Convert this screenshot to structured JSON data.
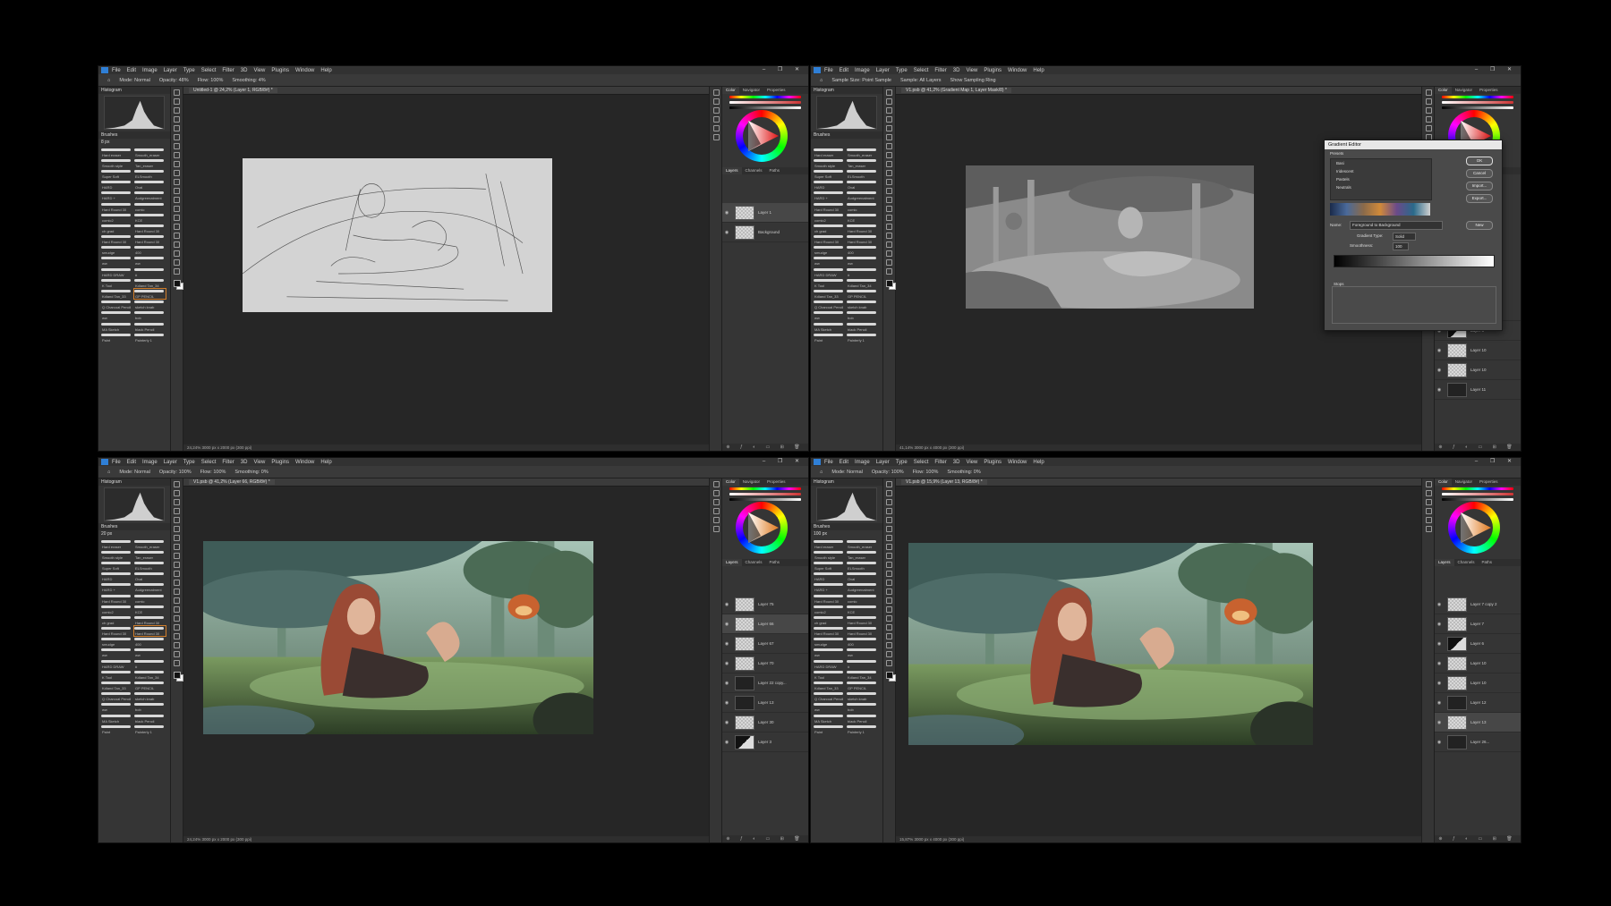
{
  "menu": [
    "File",
    "Edit",
    "Image",
    "Layer",
    "Type",
    "Select",
    "Filter",
    "3D",
    "View",
    "Plugins",
    "Window",
    "Help"
  ],
  "window_controls": "– ❐ ✕",
  "panel_titles": {
    "histogram": "Histogram",
    "brushes": "Brushes"
  },
  "right_tabs": [
    "Color",
    "Navigator",
    "Properties"
  ],
  "layer_tabs": [
    "Layers",
    "Channels",
    "Paths"
  ],
  "brushes": [
    [
      "Hard eraser",
      "Smooth_eraser"
    ],
    [
      "Smooth style",
      "Tan_eraser"
    ],
    [
      "Super Soft",
      "ELSmooth"
    ],
    [
      "HARD",
      "Oval"
    ],
    [
      "HARD +",
      "Audgreenatment"
    ],
    [
      "Hard Round 30",
      "comic"
    ],
    [
      "comic2",
      "KCE"
    ],
    [
      "ch grad",
      "Hard Round 30"
    ],
    [
      "Hard Round 30",
      "Hard Round 30"
    ],
    [
      "smudge",
      "400"
    ],
    [
      "ww",
      "ww"
    ],
    [
      "HARD DRAW",
      "#"
    ],
    [
      "K Tool",
      "Kdland Tan_34"
    ],
    [
      "Kdland Tan_33",
      "GP PENCIL"
    ],
    [
      "Q Charcoal Pencil",
      "sketch knab"
    ],
    [
      "ww",
      "bob"
    ],
    [
      "MA Sketch",
      "black Pencil"
    ],
    [
      "Paint",
      "Painterly 1"
    ]
  ],
  "panels": [
    {
      "tab": "Untitled-1 @ 24,2% (Layer 1, RGB/8#) *",
      "status": "24,24%   3000 px x 2000 px (300 ppi)",
      "options": [
        "Mode: Normal",
        "Opacity: 48%",
        "Flow: 100%",
        "Smoothing: 4%"
      ],
      "brush_size": "8 px",
      "layers": [
        {
          "name": "Layer 1",
          "thumb": "light",
          "selected": true
        },
        {
          "name": "Background",
          "thumb": "light",
          "selected": false
        }
      ]
    },
    {
      "tab": "V1.psb @ 41,2% (Gradient Map 1, Layer Mask/8) *",
      "status": "41,14%   3000 px x 4000 px (300 ppi)",
      "options": [
        "Sample Size: Point Sample",
        "Sample: All Layers",
        "Show Sampling Ring"
      ],
      "brush_size": "",
      "layers": [
        {
          "name": "Layer 7",
          "thumb": "light",
          "selected": false
        },
        {
          "name": "Layer 6",
          "thumb": "half",
          "selected": false
        },
        {
          "name": "Layer 10",
          "thumb": "light",
          "selected": false
        },
        {
          "name": "Layer 10",
          "thumb": "light",
          "selected": false
        },
        {
          "name": "Layer 11",
          "thumb": "dark",
          "selected": false
        }
      ],
      "dialog": {
        "title": "Gradient Editor",
        "presets_label": "Presets",
        "presets": [
          "Basi",
          "Iridescent",
          "Pastels",
          "Neutrals"
        ],
        "buttons": [
          "OK",
          "Cancel",
          "Import...",
          "Export..."
        ],
        "name_label": "Name:",
        "name_value": "Foreground to Background",
        "new_button": "New",
        "type_label": "Gradient Type:",
        "type_value": "Solid",
        "smooth_label": "Smoothness:",
        "smooth_value": "100",
        "stops_label": "Stops"
      }
    },
    {
      "tab": "V1.psb @ 41,2% (Layer 66, RGB/8#) *",
      "status": "24,24%   3000 px x 2000 px (300 ppi)",
      "options": [
        "Mode: Normal",
        "Opacity: 100%",
        "Flow: 100%",
        "Smoothing: 0%"
      ],
      "brush_size": "20 px",
      "layers": [
        {
          "name": "Layer 75",
          "thumb": "light",
          "selected": false
        },
        {
          "name": "Layer 66",
          "thumb": "light",
          "selected": true
        },
        {
          "name": "Layer 67",
          "thumb": "light",
          "selected": false
        },
        {
          "name": "Layer 70",
          "thumb": "light",
          "selected": false
        },
        {
          "name": "Layer 22 copy...",
          "thumb": "dark",
          "selected": false
        },
        {
          "name": "Layer 13",
          "thumb": "dark",
          "selected": false
        },
        {
          "name": "Layer 30",
          "thumb": "light",
          "selected": false
        },
        {
          "name": "Layer 3",
          "thumb": "half",
          "selected": false
        }
      ]
    },
    {
      "tab": "V1.psb @ 15,9% (Layer 13, RGB/8#) *",
      "status": "15,87%   3000 px x 4000 px (300 ppi)",
      "options": [
        "Mode: Normal",
        "Opacity: 100%",
        "Flow: 100%",
        "Smoothing: 0%"
      ],
      "brush_size": "100 px",
      "layers": [
        {
          "name": "Layer 7 copy 2",
          "thumb": "light",
          "selected": false
        },
        {
          "name": "Layer 7",
          "thumb": "light",
          "selected": false
        },
        {
          "name": "Layer 6",
          "thumb": "half",
          "selected": false
        },
        {
          "name": "Layer 10",
          "thumb": "light",
          "selected": false
        },
        {
          "name": "Layer 10",
          "thumb": "light",
          "selected": false
        },
        {
          "name": "Layer 12",
          "thumb": "dark",
          "selected": false
        },
        {
          "name": "Layer 13",
          "thumb": "light",
          "selected": true
        },
        {
          "name": "Layer 26...",
          "thumb": "dark",
          "selected": false
        }
      ]
    }
  ],
  "colors": {
    "accent": "#d07d2a",
    "ps_blue": "#2f7fd6",
    "ui_bg": "#2b2b2b"
  }
}
